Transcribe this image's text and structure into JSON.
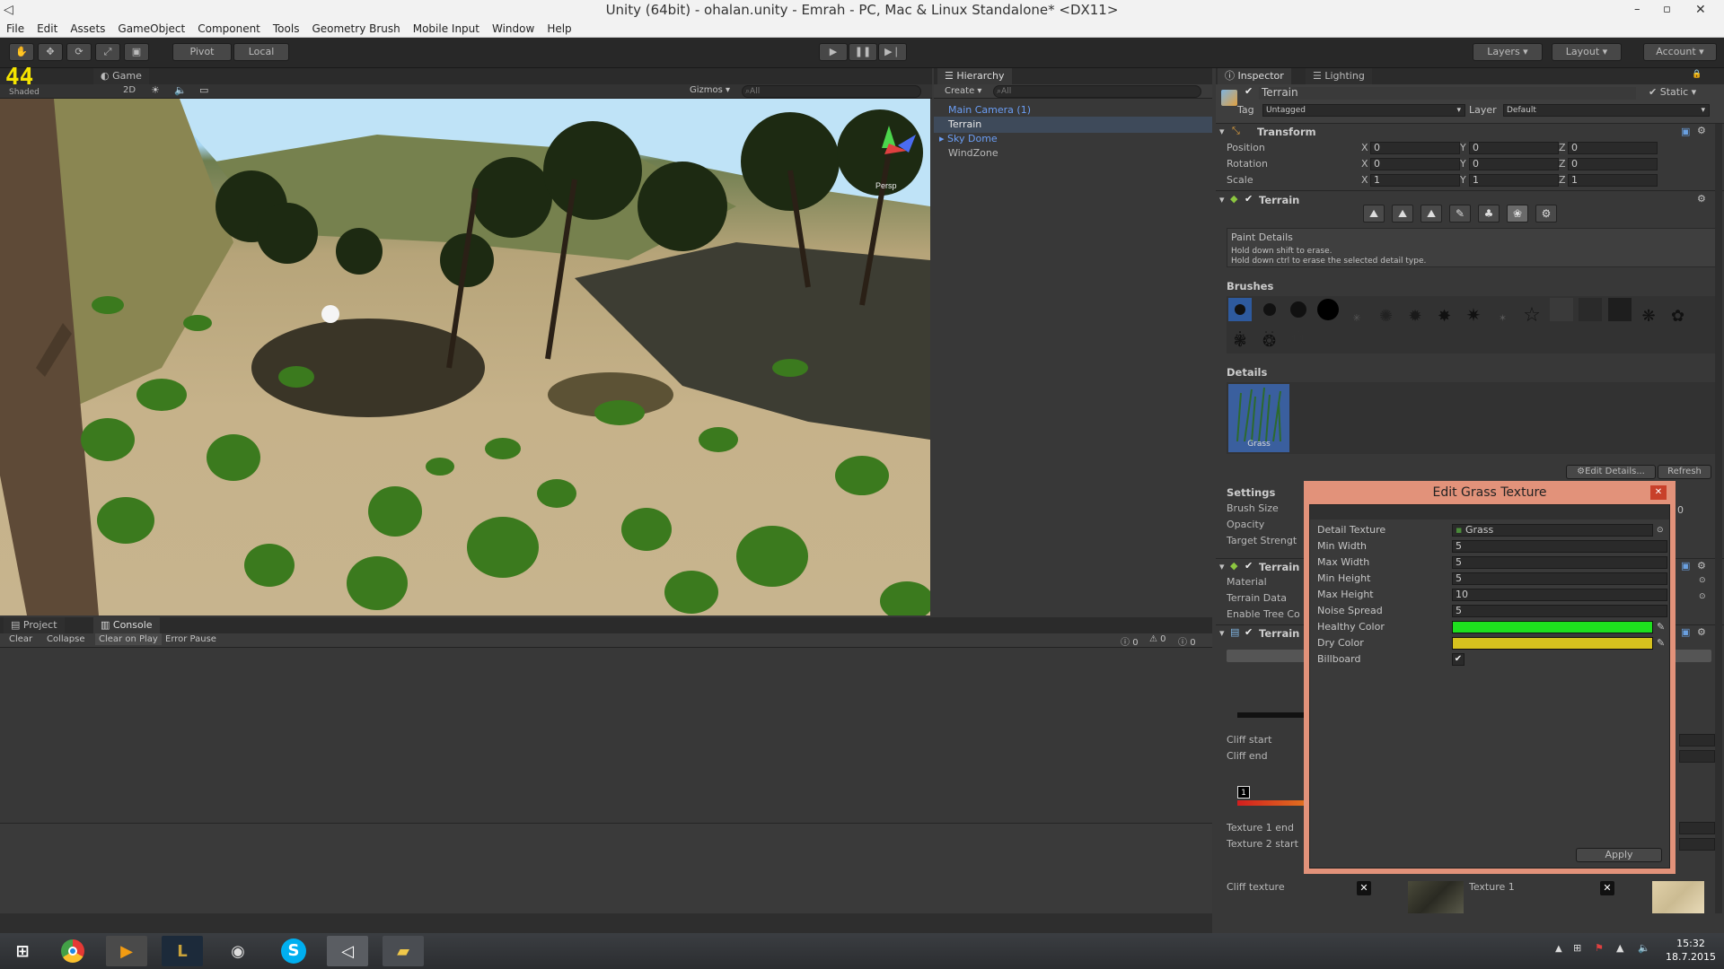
{
  "window": {
    "title": "Unity (64bit) - ohalan.unity - Emrah - PC, Mac & Linux Standalone* <DX11>"
  },
  "menu": [
    "File",
    "Edit",
    "Assets",
    "GameObject",
    "Component",
    "Tools",
    "Geometry Brush",
    "Mobile Input",
    "Window",
    "Help"
  ],
  "toolbar": {
    "pivot": "Pivot",
    "local": "Local",
    "layers": "Layers",
    "layout": "Layout",
    "account": "Account"
  },
  "scene": {
    "fps": "44",
    "shaded": "Shaded",
    "mode2d": "2D",
    "gizmos": "Gizmos",
    "search": "All",
    "game_tab": "Game",
    "persp": "Persp"
  },
  "hierarchy": {
    "tab": "Hierarchy",
    "create": "Create",
    "search": "All",
    "items": [
      "Main Camera (1)",
      "Terrain",
      "Sky Dome",
      "WindZone"
    ]
  },
  "inspector": {
    "tab": "Inspector",
    "lighting_tab": "Lighting",
    "object_name": "Terrain",
    "static_label": "Static",
    "tag_label": "Tag",
    "tag_value": "Untagged",
    "layer_label": "Layer",
    "layer_value": "Default",
    "transform": {
      "title": "Transform",
      "position": "Position",
      "rotation": "Rotation",
      "scale": "Scale",
      "pos": [
        "0",
        "0",
        "0"
      ],
      "rot": [
        "0",
        "0",
        "0"
      ],
      "scl": [
        "1",
        "1",
        "1"
      ],
      "axes": [
        "X",
        "Y",
        "Z"
      ]
    },
    "terrain": {
      "title": "Terrain",
      "paint_title": "Paint Details",
      "hint1": "Hold down shift to erase.",
      "hint2": "Hold down ctrl to erase the selected detail type.",
      "brushes": "Brushes",
      "details": "Details",
      "grass_label": "Grass",
      "edit_details": "Edit Details...",
      "refresh": "Refresh",
      "settings": "Settings",
      "brush_size": "Brush Size",
      "opacity": "Opacity",
      "target_strength": "Target Strengt",
      "opacity_value": "0"
    },
    "collider": {
      "title": "Terrain",
      "material": "Material",
      "terrain_data": "Terrain Data",
      "enable_tree": "Enable Tree Co"
    },
    "script": {
      "title": "Terrain",
      "cliff_start": "Cliff start",
      "cliff_end": "Cliff end",
      "tex1_end": "Texture 1 end",
      "tex2_start": "Texture 2 start",
      "cliff_texture": "Cliff texture",
      "texture1": "Texture 1",
      "marker": "1"
    }
  },
  "bottom": {
    "project_tab": "Project",
    "console_tab": "Console",
    "clear": "Clear",
    "collapse": "Collapse",
    "clear_on_play": "Clear on Play",
    "error_pause": "Error Pause",
    "counts": [
      "0",
      "0",
      "0"
    ]
  },
  "dialog": {
    "title": "Edit Grass Texture",
    "detail_texture": "Detail Texture",
    "detail_value": "Grass",
    "min_width": "Min Width",
    "min_width_v": "5",
    "max_width": "Max Width",
    "max_width_v": "5",
    "min_height": "Min Height",
    "min_height_v": "5",
    "max_height": "Max Height",
    "max_height_v": "10",
    "noise_spread": "Noise Spread",
    "noise_spread_v": "5",
    "healthy_color": "Healthy Color",
    "healthy_hex": "#1ee01e",
    "dry_color": "Dry Color",
    "dry_hex": "#d6c21e",
    "billboard": "Billboard",
    "apply": "Apply"
  },
  "taskbar": {
    "time": "15:32",
    "date": "18.7.2015"
  }
}
